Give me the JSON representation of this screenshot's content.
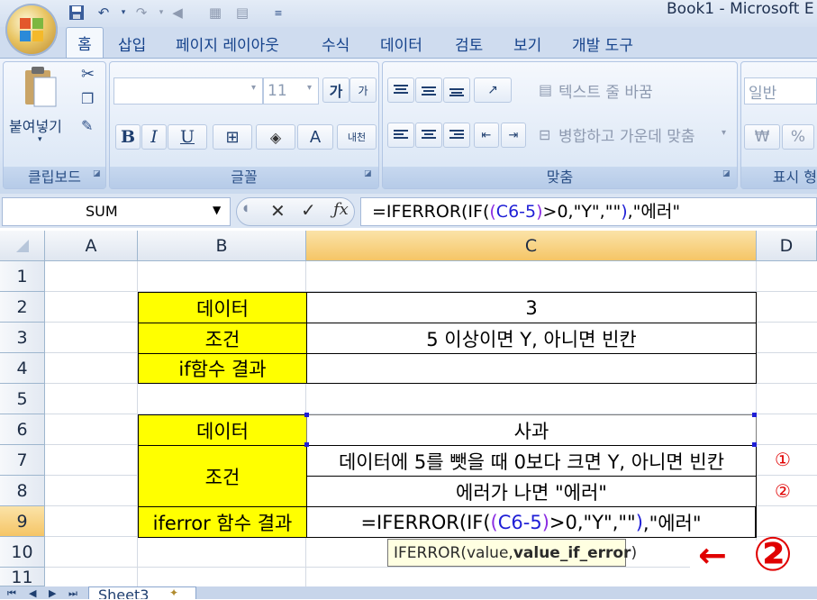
{
  "window": {
    "title": "Book1 - Microsoft E"
  },
  "tabs": [
    {
      "label": "홈"
    },
    {
      "label": "삽입"
    },
    {
      "label": "페이지 레이아웃"
    },
    {
      "label": "수식"
    },
    {
      "label": "데이터"
    },
    {
      "label": "검토"
    },
    {
      "label": "보기"
    },
    {
      "label": "개발 도구"
    }
  ],
  "ribbon": {
    "clipboard": {
      "paste_label": "붙여넣기",
      "group_label": "클립보드"
    },
    "font": {
      "size": "11",
      "grow": "가",
      "shrink": "가",
      "bold": "B",
      "italic": "I",
      "underline": "U",
      "font_color_letter": "A",
      "phonetic": "내천",
      "group_label": "글꼴"
    },
    "alignment": {
      "wrap_text": "텍스트 줄 바꿈",
      "merge_center": "병합하고 가운데 맞춤",
      "group_label": "맞춤"
    },
    "number": {
      "format": "일반",
      "currency": "₩",
      "percent": "%",
      "group_label": "표시 형"
    }
  },
  "formula_bar": {
    "name_box": "SUM",
    "formula": {
      "p1": "=IFERROR(IF(",
      "p2": "(",
      "p3": "C6-5",
      "p4": ")",
      "p5": ">0,\"Y\",\"\"",
      "p6": ")",
      "p7": ",\"에러\""
    }
  },
  "sheet": {
    "columns": [
      "A",
      "B",
      "C",
      "D"
    ],
    "rows": [
      "1",
      "2",
      "3",
      "4",
      "5",
      "6",
      "7",
      "8",
      "9",
      "10",
      "11"
    ],
    "cells": {
      "b2": "데이터",
      "c2": "3",
      "b3": "조건",
      "c3": "5 이상이면 Y, 아니면 빈칸",
      "b4": "if함수 결과",
      "c4": "",
      "b6": "데이터",
      "c6": "사과",
      "b7": "조건",
      "c7": "데이터에 5를 뺏을 때 0보다 크면 Y, 아니면 빈칸",
      "c8": "에러가 나면 \"에러\"",
      "b9": "iferror 함수 결과",
      "c9": {
        "p1": "=IFERROR(IF(",
        "p2": "(",
        "p3": "C6-5",
        "p4": ")",
        "p5": ">0,\"Y\",\"\"",
        "p6": ")",
        "p7": ",\"에러\""
      }
    },
    "markers": {
      "m1": "①",
      "m2": "②"
    },
    "tooltip": {
      "prefix": "IFERROR(value, ",
      "bold": "value_if_error",
      "suffix": ")"
    },
    "annotation": {
      "arrow": "←",
      "number": "②"
    },
    "sheet_tab": "Sheet3"
  },
  "colors": {
    "accent_yellow": "#ffff00",
    "header_selected": "#f5c566",
    "ribbon_text": "#15428b",
    "ref_blue": "#1f1fd6",
    "paren_purple": "#8a2be2",
    "marker_red": "#e00000"
  }
}
